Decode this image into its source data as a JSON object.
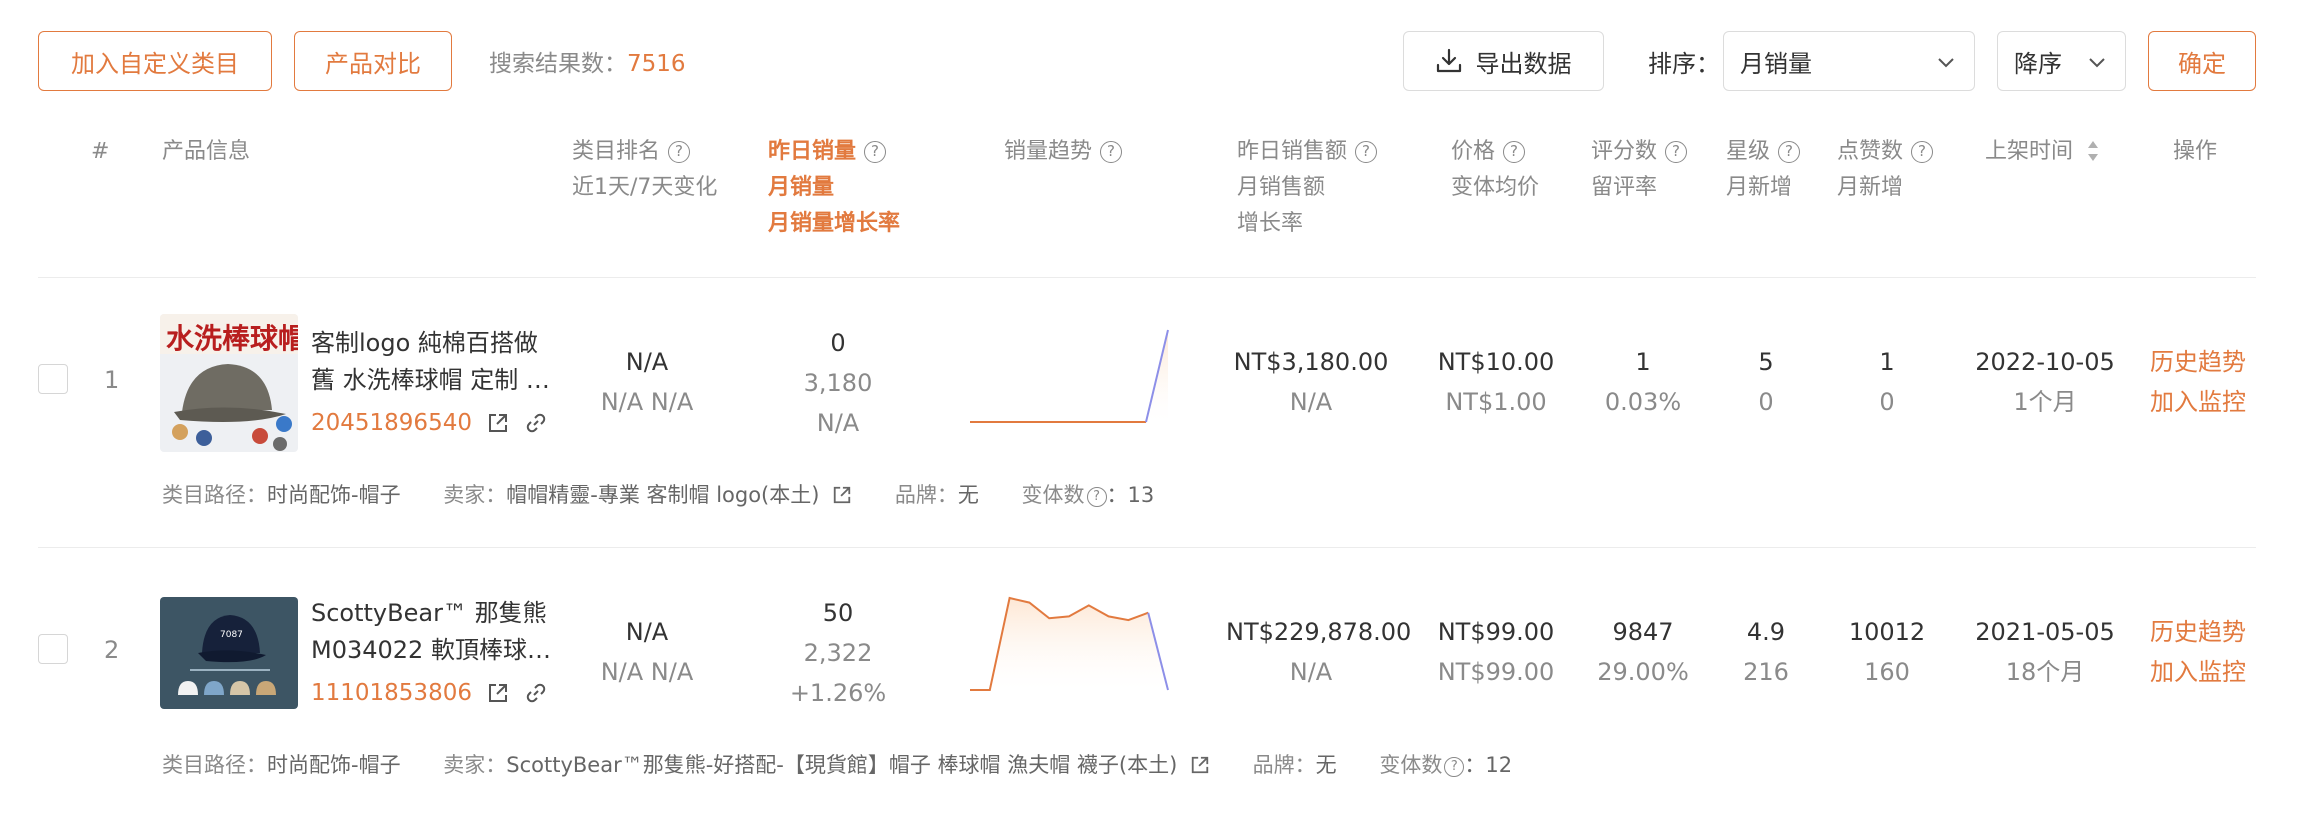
{
  "toolbar": {
    "add_category": "加入自定义类目",
    "compare": "产品对比",
    "result_label": "搜索结果数：",
    "result_count": "7516",
    "export": "导出数据",
    "sort_label": "排序：",
    "sort_value": "月销量",
    "order_value": "降序",
    "confirm": "确定"
  },
  "header": {
    "index": "#",
    "product_info": "产品信息",
    "category_rank": "类目排名",
    "rank_change": "近1天/7天变化",
    "yesterday_sales": "昨日销量",
    "monthly_sales": "月销量",
    "monthly_growth": "月销量增长率",
    "sales_trend": "销量趋势",
    "yesterday_revenue": "昨日销售额",
    "monthly_revenue": "月销售额",
    "revenue_growth": "增长率",
    "price": "价格",
    "variant_avg_price": "变体均价",
    "rating_count": "评分数",
    "review_rate": "留评率",
    "stars": "星级",
    "stars_new": "月新增",
    "likes": "点赞数",
    "likes_new": "月新增",
    "listed_time": "上架时间",
    "actions": "操作"
  },
  "rows": [
    {
      "num": "1",
      "title_line1": "客制logo 純棉百搭做",
      "title_line2": "舊 水洗棒球帽 定制 …",
      "id": "20451896540",
      "rank": "N/A",
      "rank_change": "N/A N/A",
      "yesterday_sales": "0",
      "monthly_sales": "3,180",
      "monthly_growth": "N/A",
      "yesterday_revenue": "NT$3,180.00",
      "revenue_growth": "N/A",
      "price": "NT$10.00",
      "variant_avg_price": "NT$1.00",
      "rating_count": "1",
      "review_rate": "0.03%",
      "stars": "5",
      "stars_new": "0",
      "likes": "1",
      "likes_new": "0",
      "listed_date": "2022-10-05",
      "listed_age": "1个月",
      "action_history": "历史趋势",
      "action_monitor": "加入监控",
      "meta_category_label": "类目路径：",
      "meta_category": "时尚配饰-帽子",
      "meta_seller_label": "卖家：",
      "meta_seller": "帽帽精靈-專業 客制帽 logo(本土)",
      "meta_brand_label": "品牌：",
      "meta_brand": "无",
      "meta_variants_label": "变体数",
      "meta_variants": "：13",
      "trend": [
        0,
        0,
        0,
        0,
        0,
        0,
        0,
        0,
        0,
        1
      ]
    },
    {
      "num": "2",
      "title_line1": "ScottyBear™ 那隻熊",
      "title_line2": "M034022 軟頂棒球…",
      "id": "11101853806",
      "rank": "N/A",
      "rank_change": "N/A N/A",
      "yesterday_sales": "50",
      "monthly_sales": "2,322",
      "monthly_growth": "+1.26%",
      "yesterday_revenue": "NT$229,878.00",
      "revenue_growth": "N/A",
      "price": "NT$99.00",
      "variant_avg_price": "NT$99.00",
      "rating_count": "9847",
      "review_rate": "29.00%",
      "stars": "4.9",
      "stars_new": "216",
      "likes": "10012",
      "likes_new": "160",
      "listed_date": "2021-05-05",
      "listed_age": "18个月",
      "action_history": "历史趋势",
      "action_monitor": "加入监控",
      "meta_category_label": "类目路径：",
      "meta_category": "时尚配饰-帽子",
      "meta_seller_label": "卖家：",
      "meta_seller": "ScottyBear™那隻熊-好搭配-【現貨館】帽子 棒球帽 漁夫帽 襪子(本土)",
      "meta_brand_label": "品牌：",
      "meta_brand": "无",
      "meta_variants_label": "变体数",
      "meta_variants": "：12",
      "trend": [
        0,
        0,
        1,
        0.95,
        0.78,
        0.8,
        0.92,
        0.8,
        0.76,
        0.84,
        0
      ]
    }
  ],
  "colors": {
    "accent": "#e27a3f",
    "trend_fill": "#fde7d4",
    "trend_tail": "#8d8fe8"
  }
}
